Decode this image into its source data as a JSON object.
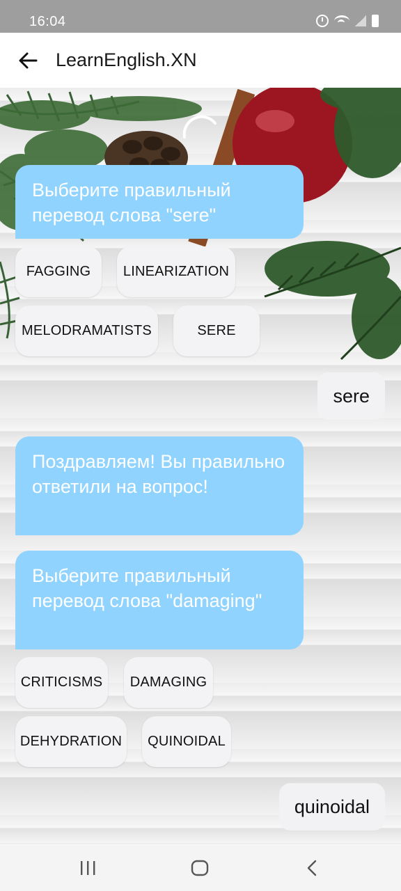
{
  "status_bar": {
    "time": "16:04",
    "icons": [
      "alarm-icon",
      "wifi-icon",
      "signal-icon",
      "battery-icon"
    ]
  },
  "app_bar": {
    "title": "LearnEnglish.XN",
    "back_icon": "arrow-left-icon"
  },
  "colors": {
    "bot_bubble": "#8fd3fe",
    "chip_bg": "#f3f3f5",
    "status_bar": "#9e9e9e"
  },
  "chat": {
    "q1": {
      "text": "Выберите правильный перевод слова \"sere\"",
      "options": [
        "FAGGING",
        "LINEARIZATION",
        "MELODRAMATISTS",
        "SERE"
      ]
    },
    "a1": "sere",
    "feedback1": "Поздравляем! Вы правильно ответили на вопрос!",
    "q2": {
      "text": "Выберите правильный перевод слова \"damaging\"",
      "options": [
        "CRITICISMS",
        "DAMAGING",
        "DEHYDRATION",
        "QUINOIDAL"
      ]
    },
    "a2": "quinoidal"
  },
  "nav_bar": {
    "buttons": [
      "recent-apps-icon",
      "home-icon",
      "back-nav-icon"
    ]
  }
}
